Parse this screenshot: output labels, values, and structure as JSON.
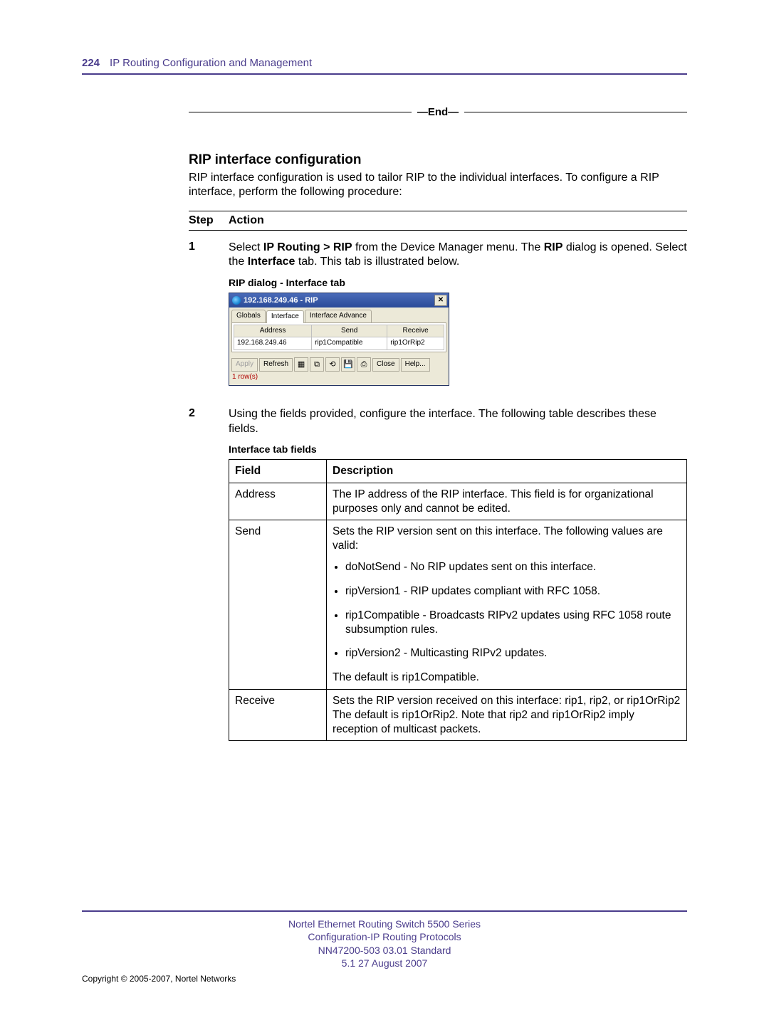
{
  "header": {
    "page_number": "224",
    "chapter": "IP Routing Configuration and Management"
  },
  "end_marker": "—End—",
  "section": {
    "title": "RIP interface configuration",
    "intro": "RIP interface configuration is used to tailor RIP to the individual interfaces. To configure a RIP interface, perform the following procedure:"
  },
  "step_header": {
    "step": "Step",
    "action": "Action"
  },
  "steps": {
    "s1": {
      "num": "1",
      "text_prefix": "Select ",
      "bold1": "IP Routing > RIP",
      "mid1": " from the Device Manager menu. The ",
      "bold2": "RIP",
      "mid2": " dialog is opened. Select the ",
      "bold3": "Interface",
      "suffix": " tab. This tab is illustrated below."
    },
    "dialog_caption": "RIP dialog - Interface tab",
    "s2": {
      "num": "2",
      "text": "Using the fields provided, configure the interface. The following table describes these fields."
    },
    "fields_caption": "Interface tab fields"
  },
  "dialog": {
    "title": "192.168.249.46 - RIP",
    "tabs": {
      "t1": "Globals",
      "t2": "Interface",
      "t3": "Interface Advance"
    },
    "cols": {
      "c1": "Address",
      "c2": "Send",
      "c3": "Receive"
    },
    "row": {
      "address": "192.168.249.46",
      "send": "rip1Compatible",
      "receive": "rip1OrRip2"
    },
    "buttons": {
      "apply": "Apply",
      "refresh": "Refresh",
      "close": "Close",
      "help": "Help..."
    },
    "rowcount": "1 row(s)"
  },
  "field_table": {
    "head": {
      "field": "Field",
      "desc": "Description"
    },
    "r1": {
      "field": "Address",
      "desc": "The IP address of the RIP interface. This field is for organizational purposes only and cannot be edited."
    },
    "r2": {
      "field": "Send",
      "intro": "Sets the RIP version sent on this interface. The following values are valid:",
      "b1": "doNotSend - No RIP updates sent on this interface.",
      "b2": "ripVersion1 - RIP updates compliant with RFC 1058.",
      "b3": "rip1Compatible - Broadcasts RIPv2 updates using RFC 1058 route subsumption rules.",
      "b4": "ripVersion2 - Multicasting RIPv2 updates.",
      "outro": "The default is rip1Compatible."
    },
    "r3": {
      "field": "Receive",
      "desc": "Sets the RIP version received on this interface: rip1, rip2, or rip1OrRip2 The default is rip1OrRip2. Note that rip2 and rip1OrRip2 imply reception of multicast packets."
    }
  },
  "footer": {
    "line1": "Nortel Ethernet Routing Switch 5500 Series",
    "line2": "Configuration-IP Routing Protocols",
    "line3": "NN47200-503   03.01   Standard",
    "line4": "5.1   27 August 2007",
    "copyright": "Copyright © 2005-2007, Nortel Networks"
  }
}
